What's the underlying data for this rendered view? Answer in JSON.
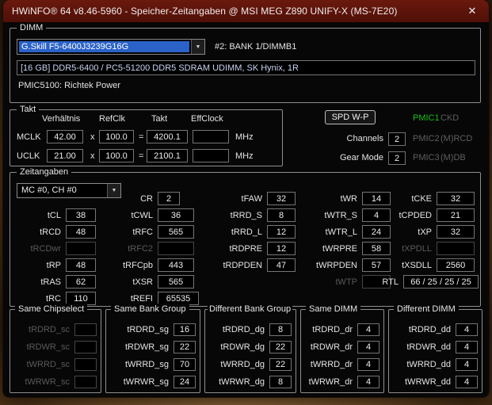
{
  "window": {
    "title": "HWiNFO® 64 v8.46-5960 - Speicher-Zeitangaben @ MSI MEG Z890 UNIFY-X (MS-7E20)",
    "close_icon": "✕"
  },
  "dimm": {
    "group_label": "DIMM",
    "module_selected": "G.Skill F5-6400J3239G16G",
    "dropdown_arrow": "▼",
    "slot_label": "#2: BANK 1/DIMMB1",
    "module_info": "[16 GB] DDR5-6400 / PC5-51200 DDR5 SDRAM UDIMM, SK Hynix, 1R",
    "pmic_info": "PMIC5100: Richtek Power"
  },
  "takt": {
    "group_label": "Takt",
    "headers": {
      "ratio": "Verhältnis",
      "refclk": "RefClk",
      "takt": "Takt",
      "effclock": "EffClock"
    },
    "mclk": {
      "label": "MCLK",
      "ratio": "42.00",
      "mul": "x",
      "refclk": "100.0",
      "eq": "=",
      "takt": "4200.1",
      "effclock": "",
      "unit": "MHz"
    },
    "uclk": {
      "label": "UCLK",
      "ratio": "21.00",
      "mul": "x",
      "refclk": "100.0",
      "eq": "=",
      "takt": "2100.1",
      "effclock": "",
      "unit": "MHz"
    }
  },
  "panel": {
    "spd_button": "SPD W-P",
    "channels": {
      "label": "Channels",
      "value": "2"
    },
    "gear_mode": {
      "label": "Gear Mode",
      "value": "2"
    },
    "pmic1": {
      "label": "PMIC1",
      "value": "CKD"
    },
    "pmic2": {
      "label": "PMIC2",
      "value": "(M)RCD"
    },
    "pmic3": {
      "label": "PMIC3",
      "value": "(M)DB"
    },
    "colors": {
      "pmic_active": "#17c117",
      "inactive": "#5f5f5f"
    }
  },
  "timings": {
    "group_label": "Zeitangaben",
    "channel_selected": "MC #0, CH #0",
    "dropdown_arrow": "▼",
    "cr": {
      "label": "CR",
      "value": "2"
    },
    "tfaw": {
      "label": "tFAW",
      "value": "32"
    },
    "twr": {
      "label": "tWR",
      "value": "14"
    },
    "tcke": {
      "label": "tCKE",
      "value": "32"
    },
    "tcl": {
      "label": "tCL",
      "value": "38"
    },
    "tcwl": {
      "label": "tCWL",
      "value": "36"
    },
    "trrd_s": {
      "label": "tRRD_S",
      "value": "8"
    },
    "twtr_s": {
      "label": "tWTR_S",
      "value": "4"
    },
    "tcpded": {
      "label": "tCPDED",
      "value": "21"
    },
    "trcd": {
      "label": "tRCD",
      "value": "48"
    },
    "trfc": {
      "label": "tRFC",
      "value": "565"
    },
    "trrd_l": {
      "label": "tRRD_L",
      "value": "12"
    },
    "twtr_l": {
      "label": "tWTR_L",
      "value": "24"
    },
    "txp": {
      "label": "tXP",
      "value": "32"
    },
    "trcdwr": {
      "label": "tRCDwr",
      "value": ""
    },
    "trfc2": {
      "label": "tRFC2",
      "value": ""
    },
    "trdpre": {
      "label": "tRDPRE",
      "value": "12"
    },
    "twrpre": {
      "label": "tWRPRE",
      "value": "58"
    },
    "txpdll": {
      "label": "tXPDLL",
      "value": ""
    },
    "trp": {
      "label": "tRP",
      "value": "48"
    },
    "trfcpb": {
      "label": "tRFCpb",
      "value": "443"
    },
    "trdpden": {
      "label": "tRDPDEN",
      "value": "47"
    },
    "twrpden": {
      "label": "tWRPDEN",
      "value": "57"
    },
    "txsdll": {
      "label": "tXSDLL",
      "value": "2560"
    },
    "tras": {
      "label": "tRAS",
      "value": "62"
    },
    "txsr": {
      "label": "tXSR",
      "value": "565"
    },
    "twtp": {
      "label": "tWTP",
      "value": ""
    },
    "rtl": {
      "label": "RTL",
      "value": "66 / 25 / 25 / 25"
    },
    "trc": {
      "label": "tRC",
      "value": "110"
    },
    "trefi": {
      "label": "tREFI",
      "value": "65535"
    }
  },
  "groups": {
    "sc": {
      "label": "Same Chipselect",
      "rows": [
        {
          "label": "tRDRD_sc",
          "value": ""
        },
        {
          "label": "tRDWR_sc",
          "value": ""
        },
        {
          "label": "tWRRD_sc",
          "value": ""
        },
        {
          "label": "tWRWR_sc",
          "value": ""
        }
      ]
    },
    "sg": {
      "label": "Same Bank Group",
      "rows": [
        {
          "label": "tRDRD_sg",
          "value": "16"
        },
        {
          "label": "tRDWR_sg",
          "value": "22"
        },
        {
          "label": "tWRRD_sg",
          "value": "70"
        },
        {
          "label": "tWRWR_sg",
          "value": "24"
        }
      ]
    },
    "dg": {
      "label": "Different Bank Group",
      "rows": [
        {
          "label": "tRDRD_dg",
          "value": "8"
        },
        {
          "label": "tRDWR_dg",
          "value": "22"
        },
        {
          "label": "tWRRD_dg",
          "value": "22"
        },
        {
          "label": "tWRWR_dg",
          "value": "8"
        }
      ]
    },
    "dr": {
      "label": "Same DIMM",
      "rows": [
        {
          "label": "tRDRD_dr",
          "value": "4"
        },
        {
          "label": "tRDWR_dr",
          "value": "4"
        },
        {
          "label": "tWRRD_dr",
          "value": "4"
        },
        {
          "label": "tWRWR_dr",
          "value": "4"
        }
      ]
    },
    "dd": {
      "label": "Different DIMM",
      "rows": [
        {
          "label": "tRDRD_dd",
          "value": "4"
        },
        {
          "label": "tRDWR_dd",
          "value": "4"
        },
        {
          "label": "tWRRD_dd",
          "value": "4"
        },
        {
          "label": "tWRWR_dd",
          "value": "4"
        }
      ]
    }
  }
}
